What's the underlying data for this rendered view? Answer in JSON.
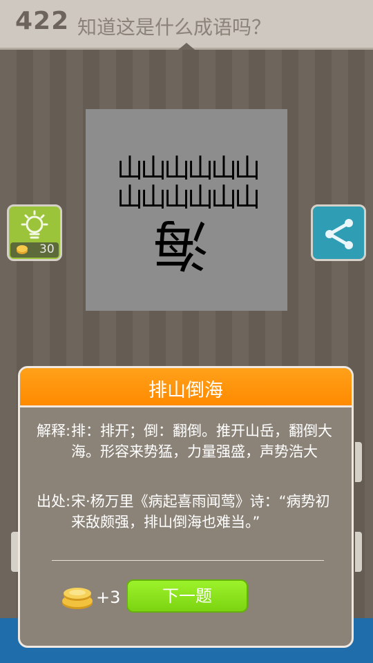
{
  "header": {
    "level_number": "422",
    "prompt": "知道这是什么成语吗？"
  },
  "puzzle": {
    "row1": "山山山山山山",
    "row2": "山山山山山山",
    "flipped_char": "海"
  },
  "hint": {
    "icon": "lightbulb-icon",
    "cost": "30"
  },
  "share": {
    "icon": "share-icon"
  },
  "dialog": {
    "title": "排山倒海",
    "explain_label": "解释:",
    "explain_text": "排：排开；倒：翻倒。推开山岳，翻倒大海。形容来势猛，力量强盛，声势浩大",
    "source_label": "出处:",
    "source_text": "宋·杨万里《病起喜雨闻莺》诗：“病势初来敌颇强，排山倒海也难当。”",
    "reward": "+3",
    "next_label": "下一题"
  },
  "colors": {
    "header_bg": "#cfc8c0",
    "dialog_header": "#ff9a10",
    "next_button": "#8ae31c",
    "hint_button": "#9bc43a",
    "share_button": "#2f9db3"
  }
}
